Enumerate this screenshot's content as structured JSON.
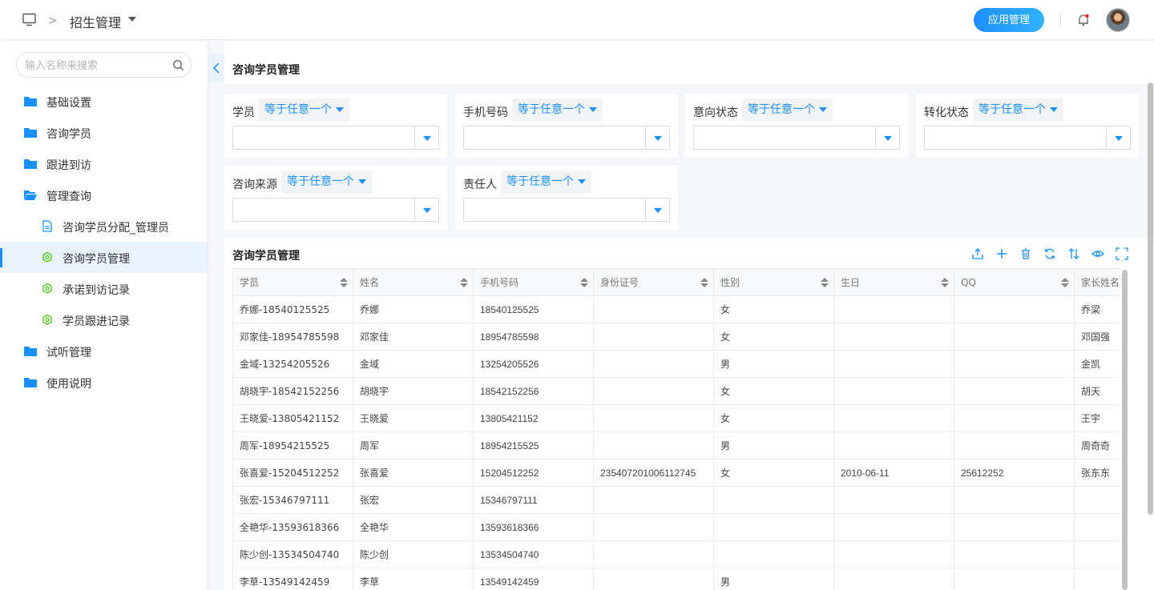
{
  "header": {
    "breadcrumb_title": "招生管理",
    "app_button": "应用管理",
    "icons": [
      "monitor-icon",
      "chevron-right-icon",
      "caret-down-icon",
      "bell-icon",
      "avatar"
    ]
  },
  "sidebar": {
    "search_placeholder": "输入名称来搜索",
    "items": [
      {
        "label": "基础设置",
        "icon": "folder-icon"
      },
      {
        "label": "咨询学员",
        "icon": "folder-icon"
      },
      {
        "label": "跟进到访",
        "icon": "folder-icon"
      },
      {
        "label": "管理查询",
        "icon": "folder-open-icon"
      },
      {
        "label": "咨询学员分配_管理员",
        "icon": "document-icon"
      },
      {
        "label": "咨询学员管理",
        "icon": "gear-icon",
        "active": true
      },
      {
        "label": "承诺到访记录",
        "icon": "gear-icon"
      },
      {
        "label": "学员跟进记录",
        "icon": "gear-icon"
      },
      {
        "label": "试听管理",
        "icon": "folder-icon"
      },
      {
        "label": "使用说明",
        "icon": "folder-icon"
      }
    ]
  },
  "page": {
    "title": "咨询学员管理"
  },
  "filters": [
    {
      "label": "学员",
      "operator": "等于任意一个"
    },
    {
      "label": "手机号码",
      "operator": "等于任意一个"
    },
    {
      "label": "意向状态",
      "operator": "等于任意一个"
    },
    {
      "label": "转化状态",
      "operator": "等于任意一个"
    },
    {
      "label": "咨询来源",
      "operator": "等于任意一个"
    },
    {
      "label": "责任人",
      "operator": "等于任意一个"
    }
  ],
  "table": {
    "title": "咨询学员管理",
    "toolbar_icons": [
      "export-icon",
      "add-icon",
      "delete-icon",
      "refresh-icon",
      "sort-icon",
      "view-icon",
      "fullscreen-icon"
    ],
    "columns": [
      "学员",
      "姓名",
      "手机号码",
      "身份证号",
      "性别",
      "生日",
      "QQ",
      "家长姓名"
    ],
    "rows": [
      [
        "乔娜-18540125525",
        "乔娜",
        "18540125525",
        "",
        "女",
        "",
        "",
        "乔梁"
      ],
      [
        "邓家佳-18954785598",
        "邓家佳",
        "18954785598",
        "",
        "女",
        "",
        "",
        "邓国强"
      ],
      [
        "金域-13254205526",
        "金域",
        "13254205526",
        "",
        "男",
        "",
        "",
        "金凯"
      ],
      [
        "胡晓宇-18542152256",
        "胡晓宇",
        "18542152256",
        "",
        "女",
        "",
        "",
        "胡天"
      ],
      [
        "王晓爱-13805421152",
        "王晓爱",
        "13805421152",
        "",
        "女",
        "",
        "",
        "王宇"
      ],
      [
        "周军-18954215525",
        "周军",
        "18954215525",
        "",
        "男",
        "",
        "",
        "周奇奇"
      ],
      [
        "张喜爱-15204512252",
        "张喜爱",
        "15204512252",
        "235407201006112745",
        "女",
        "2010-06-11",
        "25612252",
        "张东东"
      ],
      [
        "张宏-15346797111",
        "张宏",
        "15346797111",
        "",
        "",
        "",
        "",
        ""
      ],
      [
        "全艳华-13593618366",
        "全艳华",
        "13593618366",
        "",
        "",
        "",
        "",
        ""
      ],
      [
        "陈少创-13534504740",
        "陈少创",
        "13534504740",
        "",
        "",
        "",
        "",
        ""
      ],
      [
        "李草-13549142459",
        "李草",
        "13549142459",
        "",
        "男",
        "",
        "",
        ""
      ]
    ]
  },
  "colors": {
    "accent": "#1890ff",
    "active_bg": "#e8f3fd",
    "page_bg": "#f5f6f9"
  }
}
